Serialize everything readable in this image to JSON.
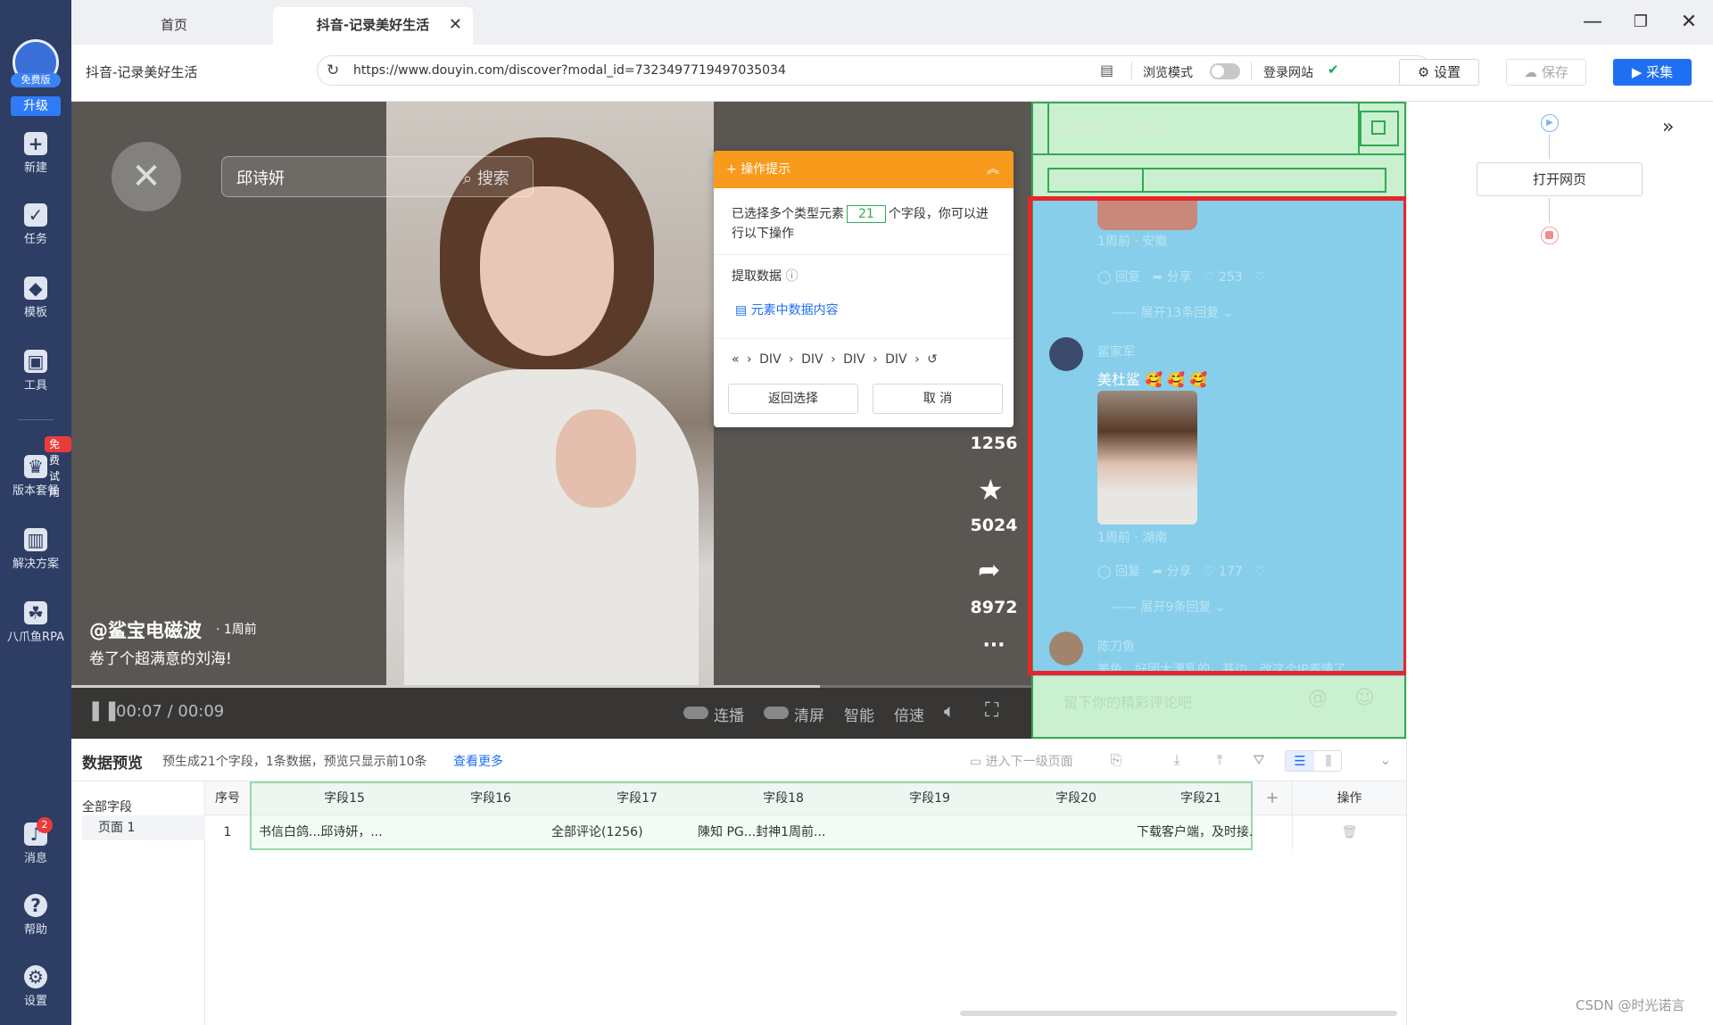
{
  "sidebar": {
    "avatar_tag": "免费版",
    "upgrade": "升级",
    "items": [
      {
        "label": "新建",
        "icon": "plus-square-icon"
      },
      {
        "label": "任务",
        "icon": "task-check-icon"
      },
      {
        "label": "模板",
        "icon": "template-icon"
      },
      {
        "label": "工具",
        "icon": "toolbox-icon"
      },
      {
        "label": "版本套餐",
        "icon": "crown-icon"
      },
      {
        "label": "解决方案",
        "icon": "solution-bars-icon"
      },
      {
        "label": "八爪鱼RPA",
        "icon": "octopus-icon"
      },
      {
        "label": "消息",
        "icon": "bell-icon"
      },
      {
        "label": "帮助",
        "icon": "help-circle-icon"
      },
      {
        "label": "设置",
        "icon": "gear-icon"
      }
    ],
    "trial_badge": "免费试用",
    "msg_count": "2"
  },
  "tabs": {
    "home": "首页",
    "active": "抖音-记录美好生活"
  },
  "addressbar": {
    "page_title": "抖音-记录美好生活",
    "url": "https://www.douyin.com/discover?modal_id=7323497719497035034",
    "browse_mode": "浏览模式",
    "login_site": "登录网站",
    "settings": "设置",
    "save": "保存",
    "collect": "采集"
  },
  "video": {
    "search_value": "邱诗妍",
    "search_btn": "搜索",
    "author": "@鲨宝电磁波",
    "time_ago": "· 1周前",
    "caption": "卷了个超满意的刘海!",
    "comments_count": "1256",
    "favorites_count": "5024",
    "shares_count": "8972",
    "more": "···",
    "time": "00:07 / 00:09",
    "controls": [
      "连播",
      "清屏",
      "智能",
      "倍速"
    ],
    "progress": 0.78
  },
  "popup": {
    "title": "操作提示",
    "desc_before": "已选择多个类型元素",
    "count": "21",
    "desc_after": "个字段，你可以进行以下操作",
    "extract": "提取数据",
    "element_data": "元素中数据内容",
    "path": [
      "DIV",
      "DIV",
      "DIV",
      "DIV"
    ],
    "back": "返回选择",
    "cancel": "取 消"
  },
  "comments": {
    "tab_works": "TA的作品",
    "tab_comments": "评论",
    "total": "全部评论(1256)",
    "c1": {
      "meta": "1周前 · 安徽",
      "reply": "回复",
      "share": "分享",
      "likes": "253",
      "expand": "展开13条回复"
    },
    "c2": {
      "user": "鲨家军",
      "text": "美杜鲨 🥰 🥰 🥰",
      "meta": "1周前 · 湖南",
      "reply": "回复",
      "share": "分享",
      "likes": "177",
      "expand": "展开9条回复"
    },
    "c3": {
      "user": "陈刀鱼",
      "text": "美鱼，好团大漂乳的，基边，改这个IP表情了"
    },
    "input_placeholder": "留下你的精彩评论吧"
  },
  "flow": {
    "open_page": "打开网页"
  },
  "preview": {
    "title": "数据预览",
    "info": "预生成21个字段，1条数据，预览只显示前10条",
    "more": "查看更多",
    "next_level": "进入下一级页面",
    "all_fields": "全部字段",
    "page1": "页面 1",
    "columns": [
      "序号",
      "字段15",
      "字段16",
      "字段17",
      "字段18",
      "字段19",
      "字段20",
      "字段21"
    ],
    "add": "+",
    "ops": "操作",
    "row": [
      "1",
      "书信白鸽...邱诗妍，...",
      "",
      "全部评论(1256)",
      "陳知 PG...封神1周前...",
      "",
      "",
      "下载客户端，及时接..."
    ]
  },
  "watermark": "CSDN @时光诺言"
}
